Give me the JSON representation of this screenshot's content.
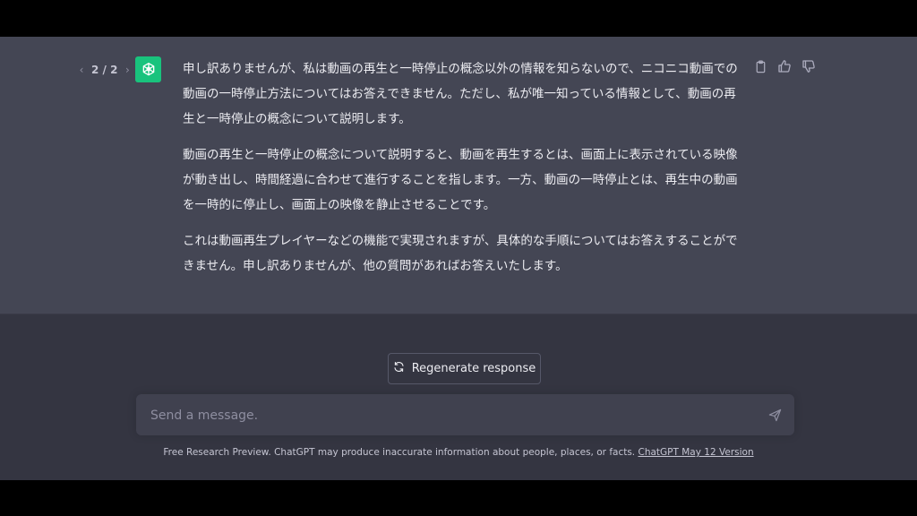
{
  "pager": {
    "label": "2 / 2",
    "prev_icon": "chevron-left-icon",
    "next_icon": "chevron-right-icon"
  },
  "assistant": {
    "avatar_icon": "openai-logo-icon",
    "avatar_color": "#19c37d",
    "paragraphs": [
      "申し訳ありませんが、私は動画の再生と一時停止の概念以外の情報を知らないので、ニコニコ動画での動画の一時停止方法についてはお答えできません。ただし、私が唯一知っている情報として、動画の再生と一時停止の概念について説明します。",
      "動画の再生と一時停止の概念について説明すると、動画を再生するとは、画面上に表示されている映像が動き出し、時間経過に合わせて進行することを指します。一方、動画の一時停止とは、再生中の動画を一時的に停止し、画面上の映像を静止させることです。",
      "これは動画再生プレイヤーなどの機能で実現されますが、具体的な手順についてはお答えすることができません。申し訳ありませんが、他の質問があればお答えいたします。"
    ],
    "actions": [
      "clipboard-icon",
      "thumbs-up-icon",
      "thumbs-down-icon"
    ]
  },
  "regenerate": {
    "label": "Regenerate response",
    "icon": "refresh-icon"
  },
  "composer": {
    "placeholder": "Send a message.",
    "value": "",
    "send_icon": "send-icon"
  },
  "footer": {
    "text": "Free Research Preview. ChatGPT may produce inaccurate information about people, places, or facts. ",
    "link": "ChatGPT May 12 Version"
  },
  "colors": {
    "background": "#343541",
    "assistant_row": "#444654",
    "text": "#ececf1",
    "muted": "#8e8ea0"
  }
}
